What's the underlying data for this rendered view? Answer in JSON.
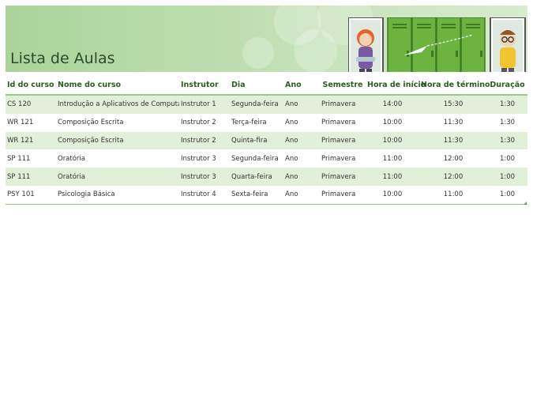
{
  "page": {
    "title": "Lista de Aulas"
  },
  "table": {
    "headers": [
      "Id do curso",
      "Nome do curso",
      "Instrutor",
      "Dia",
      "Ano",
      "Semestre",
      "Hora de início",
      "Hora de término",
      "Duração"
    ],
    "rows": [
      [
        "CS 120",
        "Introdução a Aplicativos de Computador",
        "Instrutor 1",
        "Segunda-feira",
        "Ano",
        "Primavera",
        "14:00",
        "15:30",
        "1:30"
      ],
      [
        "WR 121",
        "Composição Escrita",
        "Instrutor 2",
        "Terça-feira",
        "Ano",
        "Primavera",
        "10:00",
        "11:30",
        "1:30"
      ],
      [
        "WR 121",
        "Composição Escrita",
        "Instrutor 2",
        "Quinta-fira",
        "Ano",
        "Primavera",
        "10:00",
        "11:30",
        "1:30"
      ],
      [
        "SP 111",
        "Oratória",
        "Instrutor 3",
        "Segunda-feira",
        "Ano",
        "Primavera",
        "11:00",
        "12:00",
        "1:00"
      ],
      [
        "SP 111",
        "Oratória",
        "Instrutor 3",
        "Quarta-feira",
        "Ano",
        "Primavera",
        "11:00",
        "12:00",
        "1:00"
      ],
      [
        "PSY 101",
        "Psicologia Básica",
        "Instrutor 4",
        "Sexta-feira",
        "Ano",
        "Primavera",
        "10:00",
        "11:00",
        "1:00"
      ]
    ]
  },
  "colors": {
    "header_text": "#2e5a23",
    "band_row": "#e2f0da",
    "border": "#9bc98c",
    "locker": "#6db33f"
  }
}
